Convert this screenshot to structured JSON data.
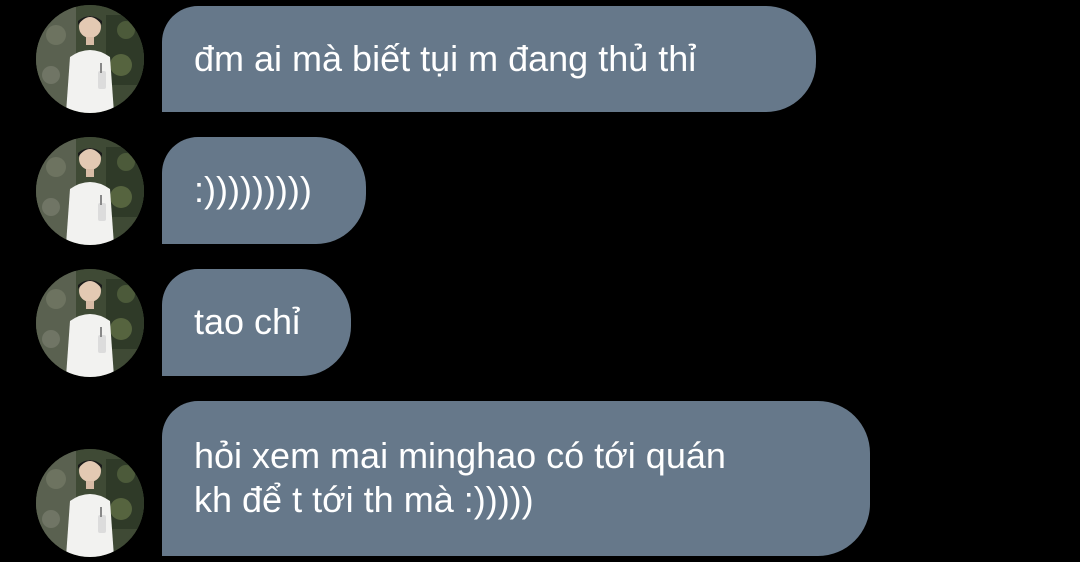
{
  "colors": {
    "background": "#000000",
    "bubble": "#66788a",
    "text": "#ffffff"
  },
  "avatar_icon": "profile-photo",
  "messages": [
    {
      "lines": [
        "đm ai mà biết tụi m đang thủ thỉ"
      ]
    },
    {
      "lines": [
        ":)))))))))"
      ]
    },
    {
      "lines": [
        "tao chỉ"
      ]
    },
    {
      "lines": [
        "hỏi xem mai minghao có tới quán",
        "kh để t tới th mà :)))))"
      ]
    }
  ]
}
